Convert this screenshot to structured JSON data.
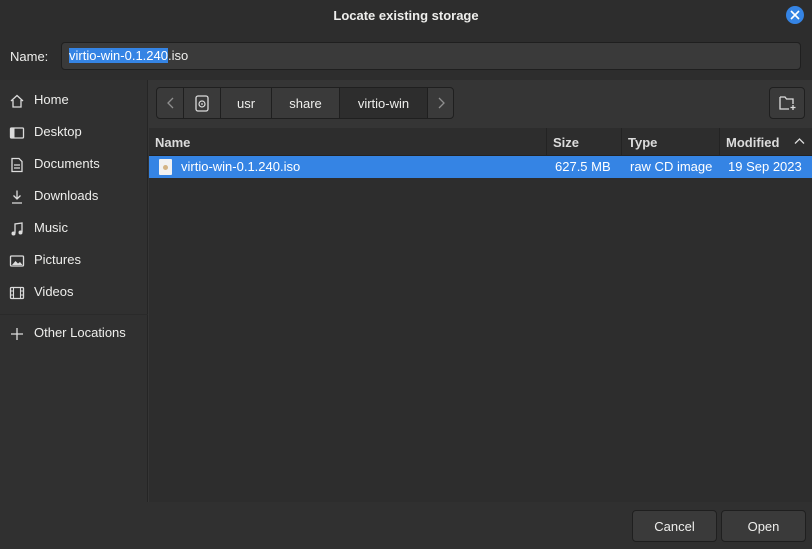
{
  "window": {
    "title": "Locate existing storage"
  },
  "name_field": {
    "label": "Name:",
    "value_selected": "virtio-win-0.1.240",
    "value_rest": ".iso"
  },
  "sidebar": {
    "items": [
      {
        "label": "Home",
        "icon": "home-icon"
      },
      {
        "label": "Desktop",
        "icon": "desktop-icon"
      },
      {
        "label": "Documents",
        "icon": "documents-icon"
      },
      {
        "label": "Downloads",
        "icon": "downloads-icon"
      },
      {
        "label": "Music",
        "icon": "music-icon"
      },
      {
        "label": "Pictures",
        "icon": "pictures-icon"
      },
      {
        "label": "Videos",
        "icon": "videos-icon"
      },
      {
        "label": "Other Locations",
        "icon": "plus-icon"
      }
    ]
  },
  "pathbar": {
    "segments": [
      "usr",
      "share",
      "virtio-win"
    ],
    "active": "virtio-win"
  },
  "columns": {
    "name": "Name",
    "size": "Size",
    "type": "Type",
    "modified": "Modified"
  },
  "files": [
    {
      "name": "virtio-win-0.1.240.iso",
      "size": "627.5 MB",
      "type": "raw CD image",
      "modified": "19 Sep 2023",
      "selected": true
    }
  ],
  "buttons": {
    "cancel": "Cancel",
    "open": "Open"
  },
  "colors": {
    "accent": "#3584e4",
    "background": "#353535"
  }
}
